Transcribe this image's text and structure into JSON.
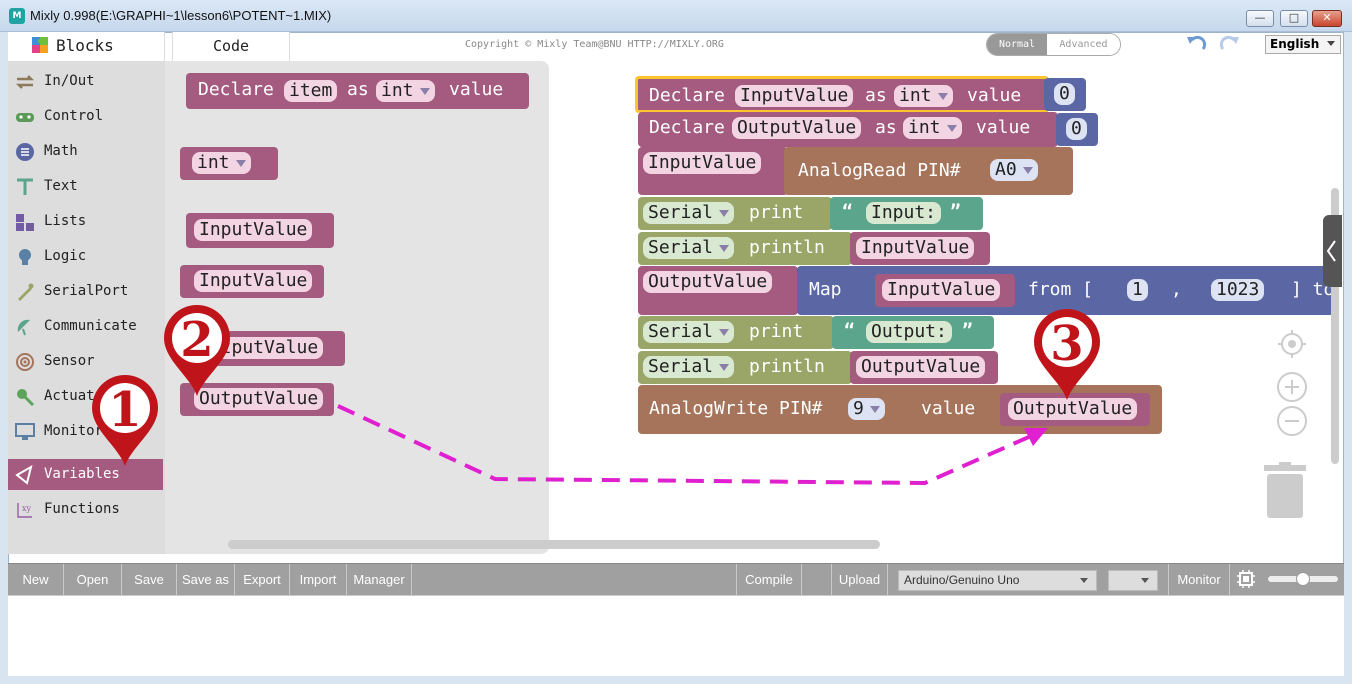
{
  "window": {
    "title": "Mixly 0.998(E:\\GRAPHI~1\\lesson6\\POTENT~1.MIX)",
    "icon_label": "M",
    "min_label": "—",
    "max_label": "□",
    "close_label": "✕"
  },
  "tabs": {
    "blocks": "Blocks",
    "code": "Code"
  },
  "copyright": "Copyright © Mixly Team@BNU HTTP://MIXLY.ORG",
  "mode": {
    "normal": "Normal",
    "advanced": "Advanced",
    "selected": "Normal"
  },
  "language": "English",
  "toolbox": {
    "items": [
      {
        "label": "In/Out",
        "icon": "arrows-icon",
        "color": "#8c7a5a"
      },
      {
        "label": "Control",
        "icon": "gamepad-icon",
        "color": "#5b9a57"
      },
      {
        "label": "Math",
        "icon": "math-icon",
        "color": "#5b67a5"
      },
      {
        "label": "Text",
        "icon": "text-icon",
        "color": "#5ba58c"
      },
      {
        "label": "Lists",
        "icon": "lists-icon",
        "color": "#745ba5"
      },
      {
        "label": "Logic",
        "icon": "bulb-icon",
        "color": "#5b80a5"
      },
      {
        "label": "SerialPort",
        "icon": "pen-icon",
        "color": "#9aa668"
      },
      {
        "label": "Communicate",
        "icon": "satellite-icon",
        "color": "#5ba58c"
      },
      {
        "label": "Sensor",
        "icon": "sensor-icon",
        "color": "#a5745b"
      },
      {
        "label": "Actuator",
        "icon": "actuator-icon",
        "color": "#5ba55b"
      },
      {
        "label": "Monitor",
        "icon": "monitor-icon",
        "color": "#5b80a5"
      },
      {
        "label": "Variables",
        "icon": "variables-icon",
        "color": "#a55b80",
        "selected": true
      },
      {
        "label": "Functions",
        "icon": "function-icon",
        "color": "#995ba5"
      }
    ]
  },
  "flyout": {
    "declare": {
      "kw": "Declare",
      "name": "item",
      "as": "as",
      "type": "int",
      "value": "value"
    },
    "type_block": "int",
    "getters": [
      "InputValue",
      "InputValue",
      "OutputValue",
      "OutputValue"
    ]
  },
  "workspace": {
    "declare1": {
      "kw": "Declare",
      "name": "InputValue",
      "as": "as",
      "type": "int",
      "value": "value",
      "num": "0"
    },
    "declare2": {
      "kw": "Declare",
      "name": "OutputValue",
      "as": "as",
      "type": "int",
      "value": "value",
      "num": "0"
    },
    "assign1": {
      "var": "InputValue",
      "fn": "AnalogRead PIN#",
      "pin": "A0"
    },
    "serial1": {
      "obj": "Serial",
      "fn": "print",
      "open_quote": "“",
      "text": "Input:",
      "close_quote": "”"
    },
    "serial2": {
      "obj": "Serial",
      "fn": "println",
      "var": "InputValue"
    },
    "assign2": {
      "var": "OutputValue",
      "fn": "Map",
      "arg": "InputValue",
      "from": "from [",
      "lo": "1",
      "comma": ",",
      "hi": "1023",
      "to": "] to"
    },
    "serial3": {
      "obj": "Serial",
      "fn": "print",
      "open_quote": "“",
      "text": "Output:",
      "close_quote": "”"
    },
    "serial4": {
      "obj": "Serial",
      "fn": "println",
      "var": "OutputValue"
    },
    "write": {
      "fn": "AnalogWrite PIN#",
      "pin": "9",
      "value": "value",
      "var": "OutputValue"
    }
  },
  "bottom_bar": {
    "new": "New",
    "open": "Open",
    "save": "Save",
    "save_as": "Save as",
    "export": "Export",
    "import": "Import",
    "manager": "Manager",
    "compile": "Compile",
    "upload": "Upload",
    "board": "Arduino/Genuino Uno",
    "port": "",
    "monitor": "Monitor"
  },
  "annotations": {
    "marker1": "1",
    "marker2": "2",
    "marker3": "3",
    "arrow_color": "#e020d0",
    "marker_color": "#c0141b"
  }
}
